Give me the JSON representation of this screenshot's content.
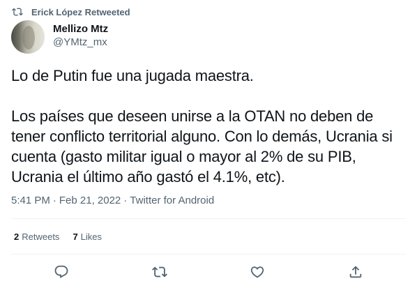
{
  "retweet_header": {
    "text": "Erick López Retweeted",
    "icon": "retweet-icon"
  },
  "author": {
    "display_name": "Mellizo Mtz",
    "handle": "@YMtz_mx"
  },
  "tweet": {
    "paragraphs": [
      "Lo de Putin fue una jugada maestra.",
      "Los países que deseen unirse a la OTAN no deben de tener conflicto territorial alguno. Con lo demás, Ucrania si cuenta (gasto militar igual o mayor al 2% de su PIB, Ucrania el último año gastó el 4.1%, etc)."
    ]
  },
  "meta": {
    "time": "5:41 PM",
    "separator": "·",
    "date": "Feb 21, 2022",
    "source": "Twitter for Android"
  },
  "stats": {
    "retweets_count": "2",
    "retweets_label": "Retweets",
    "likes_count": "7",
    "likes_label": "Likes"
  },
  "actions": {
    "reply_icon": "reply-icon",
    "retweet_icon": "retweet-icon",
    "like_icon": "heart-icon",
    "share_icon": "share-icon"
  },
  "colors": {
    "text_primary": "#0f1419",
    "text_secondary": "#536471",
    "divider": "#eff3f4"
  }
}
